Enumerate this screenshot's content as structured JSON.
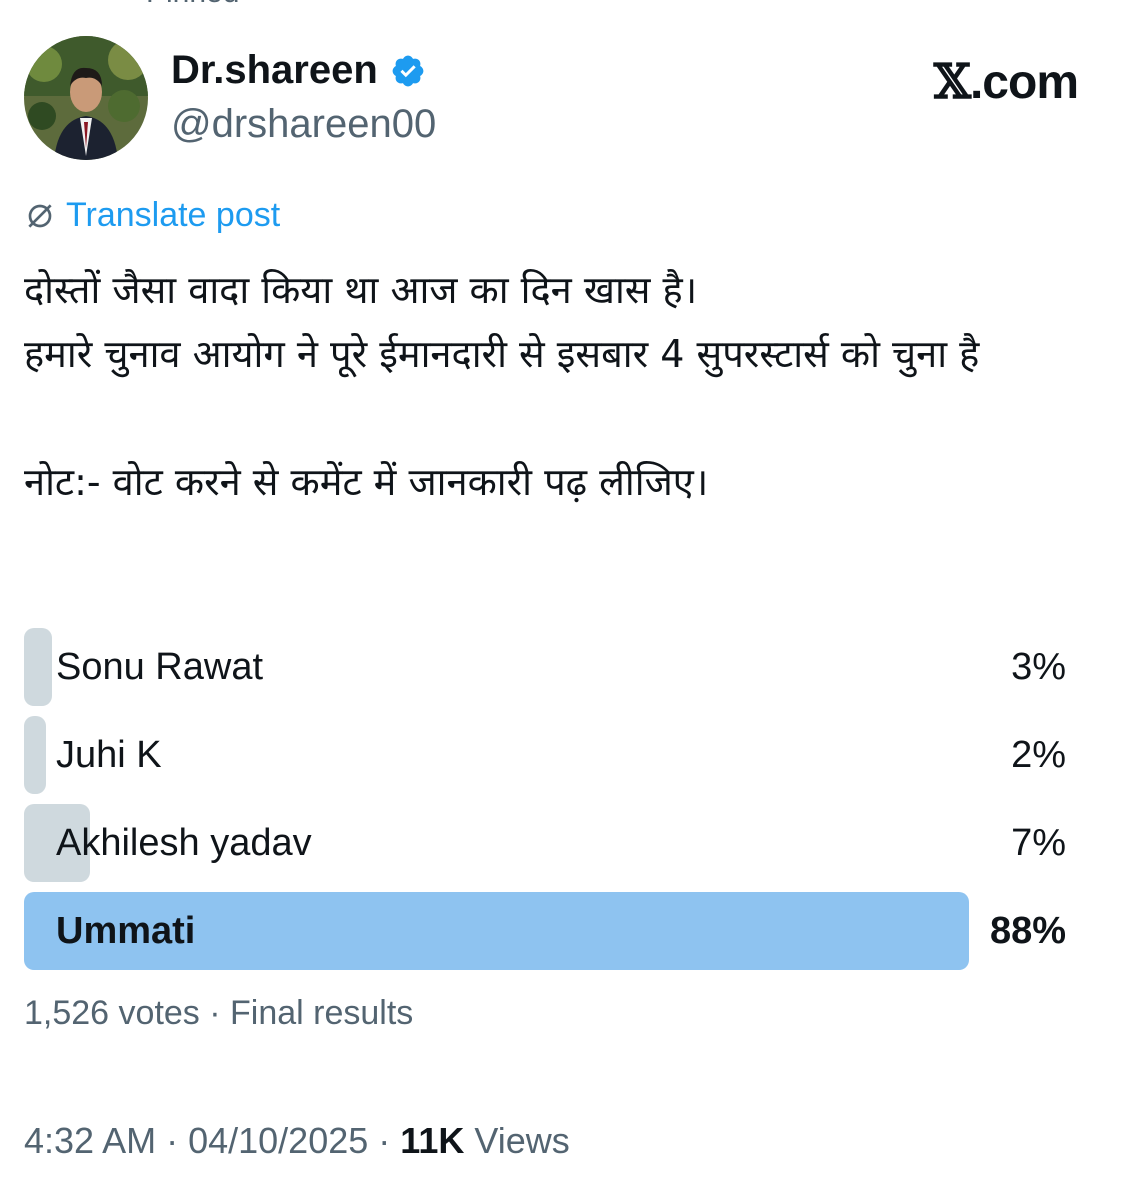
{
  "pinned_label": "Pinned",
  "author": {
    "display_name": "Dr.shareen",
    "handle": "@drshareen00",
    "verified_icon": "verified-badge-icon",
    "verified_color": "#1d9bf0"
  },
  "brand": {
    "logo_text": "com",
    "logo_mark": "𝕏",
    "logo_dot": "."
  },
  "translate": {
    "label": "Translate post",
    "icon": "globe-slash-icon"
  },
  "post": {
    "lines": [
      "दोस्तों जैसा वादा किया था आज का दिन खास है।",
      "हमारे चुनाव आयोग ने पूरे ईमानदारी से इसबार 4 सुपरस्टार्स को चुना है",
      "नोट:- वोट करने से कमेंट में जानकारी पढ़ लीजिए।"
    ]
  },
  "poll": {
    "options": [
      {
        "label": "Sonu Rawat",
        "percent_text": "3%",
        "percent": 3
      },
      {
        "label": "Juhi K",
        "percent_text": "2%",
        "percent": 2
      },
      {
        "label": "Akhilesh yadav",
        "percent_text": "7%",
        "percent": 7
      },
      {
        "label": "Ummati",
        "percent_text": "88%",
        "percent": 88,
        "winner": true
      }
    ],
    "footer": "1,526 votes · Final results",
    "bar_color": "#cfd9de",
    "winner_color": "#8ec3f0"
  },
  "meta": {
    "time": "4:32 AM",
    "date": "04/10/2025",
    "separator": "·",
    "views_count": "11K",
    "views_label": "Views"
  }
}
